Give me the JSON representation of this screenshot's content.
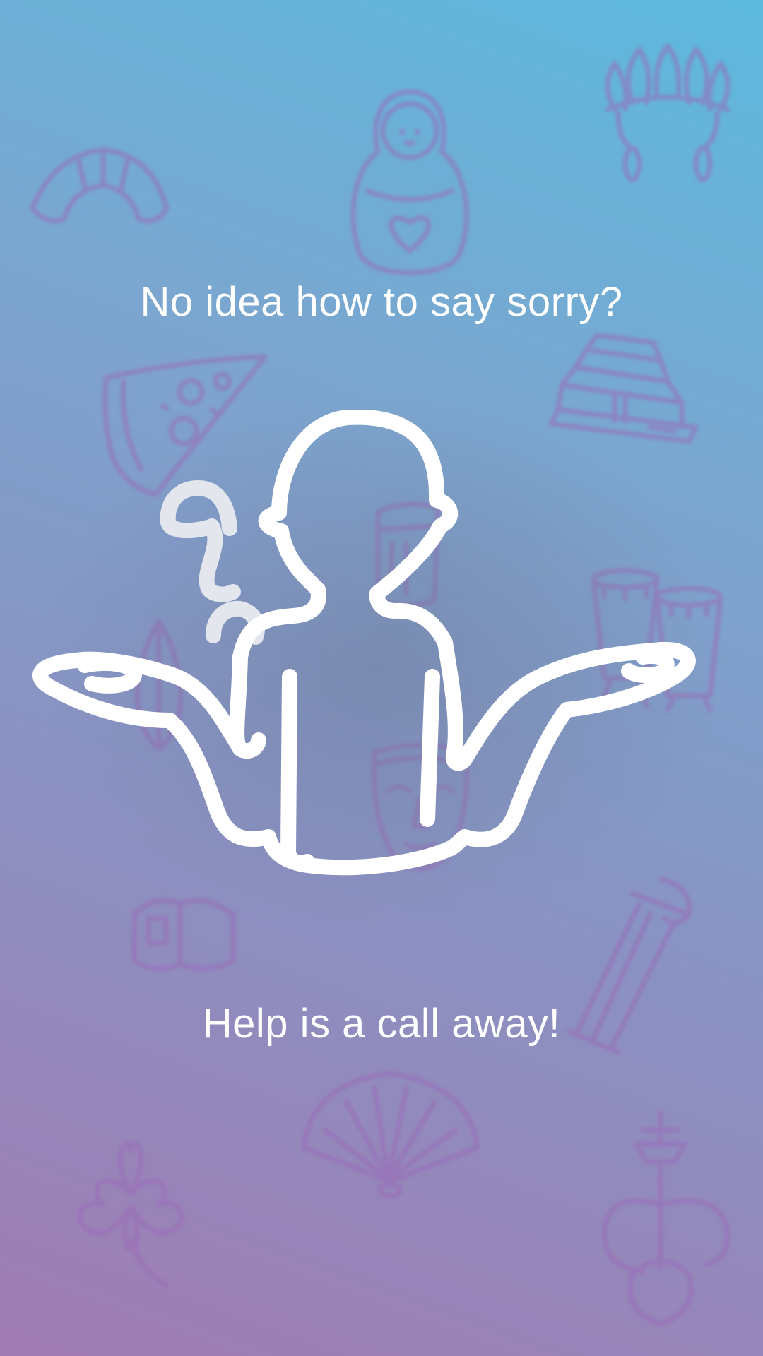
{
  "screen": {
    "headline_top": "No idea how to say sorry?",
    "headline_bottom": "Help is a call away!"
  },
  "illustration": {
    "figure_icon": "shrugging-person-icon",
    "question_mark_icon": "question-mark-icon"
  },
  "background_icons": [
    "croissant-icon",
    "matryoshka-doll-icon",
    "feather-headdress-icon",
    "pizza-slice-icon",
    "pagoda-temple-icon",
    "beer-mug-icon",
    "praying-hands-icon",
    "conga-drums-icon",
    "theater-mask-icon",
    "sushi-icon",
    "greek-column-icon",
    "folding-fan-icon",
    "four-leaf-clover-icon",
    "hookah-icon"
  ],
  "colors": {
    "gradient_top": "#5cb9de",
    "gradient_bottom": "#a07cb2",
    "icon_tint": "#9a6ab8",
    "text": "#ffffff"
  }
}
